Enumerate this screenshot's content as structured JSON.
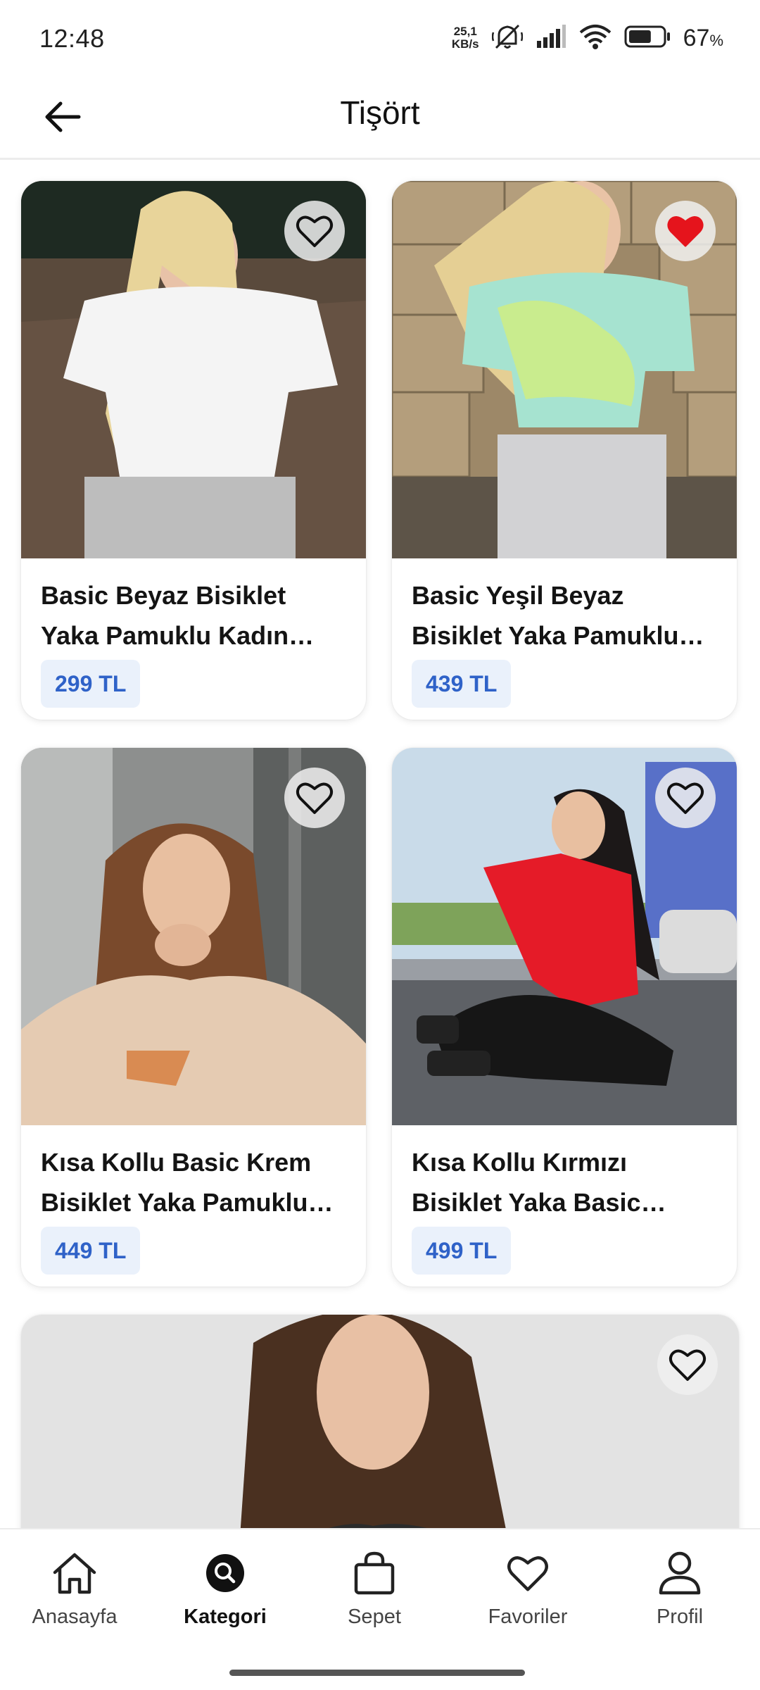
{
  "status_bar": {
    "time": "12:48",
    "net_speed_value": "25,1",
    "net_speed_unit": "KB/s",
    "battery_percent": "67",
    "battery_unit": "%",
    "battery_level": 0.67
  },
  "header": {
    "title": "Tişört",
    "back_icon": "arrow-left-icon"
  },
  "products": [
    {
      "name": "Basic Beyaz Bisiklet Yaka Pamuklu Kadın Tişört",
      "price": "299 TL",
      "favorite": false
    },
    {
      "name": "Basic Yeşil Beyaz Bisiklet Yaka Pamuklu Tişört",
      "price": "439 TL",
      "favorite": true
    },
    {
      "name": "Kısa Kollu Basic Krem Bisiklet Yaka Pamuklu Tişört",
      "price": "449 TL",
      "favorite": false
    },
    {
      "name": "Kısa Kollu Kırmızı Bisiklet Yaka Basic Pamuklu Tişört",
      "price": "499 TL",
      "favorite": false
    },
    {
      "favorite": false
    }
  ],
  "bottom_nav": {
    "items": [
      {
        "label": "Anasayfa",
        "icon": "home-icon",
        "active": false
      },
      {
        "label": "Kategori",
        "icon": "search-icon",
        "active": true
      },
      {
        "label": "Sepet",
        "icon": "bag-icon",
        "active": false
      },
      {
        "label": "Favoriler",
        "icon": "heart-icon",
        "active": false
      },
      {
        "label": "Profil",
        "icon": "user-icon",
        "active": false
      }
    ]
  },
  "colors": {
    "price_text": "#2f62c8",
    "price_bg": "#eaf1fb",
    "favorite_active": "#e5141c"
  }
}
